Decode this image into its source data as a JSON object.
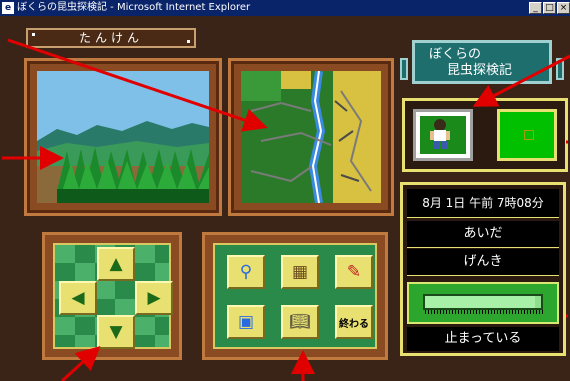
{
  "window": {
    "title": "ぼくらの昆虫探検記 - Microsoft Internet Explorer",
    "controls": {
      "minimize": "_",
      "maximize": "□",
      "close": "×"
    }
  },
  "header": {
    "label": "たんけん"
  },
  "logo": {
    "line1": "ぼくらの",
    "line2": "昆虫探検記"
  },
  "status": {
    "datetime": "8月 1日 午前 7時08分",
    "companion": "あいだ",
    "condition": "げんき",
    "stamina_level": 0.95,
    "movement": "止まっている"
  },
  "tools": {
    "magnifier": "magnifier-icon",
    "cage": "insect-cage-icon",
    "notebook": "notebook-icon",
    "backpack": "backpack-icon",
    "book": "book-icon",
    "end_label": "終わる"
  },
  "colors": {
    "panel_green": "#2a8a4a",
    "button_yellow": "#e8e070",
    "frame_brown": "#8a4a22",
    "annotation_red": "#e00000"
  }
}
